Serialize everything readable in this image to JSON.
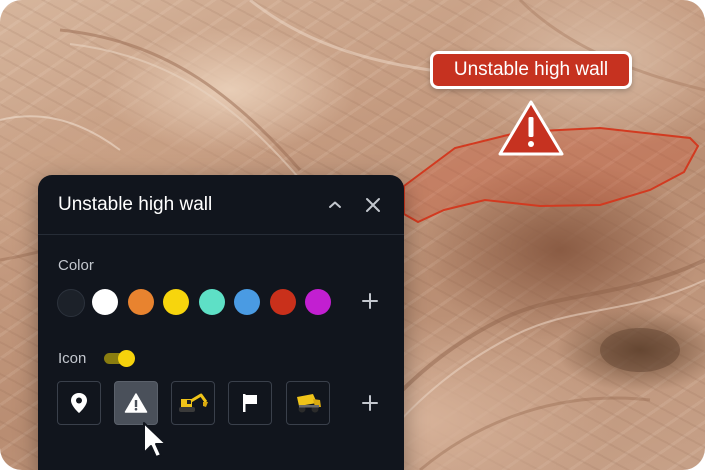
{
  "map": {
    "hazard_label": "Unstable high wall",
    "hazard_color": "#c63220"
  },
  "panel": {
    "title": "Unstable high wall",
    "color_section_label": "Color",
    "colors": [
      "#1c2129",
      "#ffffff",
      "#e8832f",
      "#f7d50d",
      "#5ee0c6",
      "#4a9be3",
      "#c9301b",
      "#c21fd1"
    ],
    "selected_color": "#c9301b",
    "icon_section_label": "Icon",
    "icon_toggle_on": true,
    "icons": [
      "location-pin-icon",
      "warning-triangle-icon",
      "excavator-icon",
      "flag-icon",
      "dump-truck-icon"
    ],
    "selected_icon": "warning-triangle-icon"
  }
}
